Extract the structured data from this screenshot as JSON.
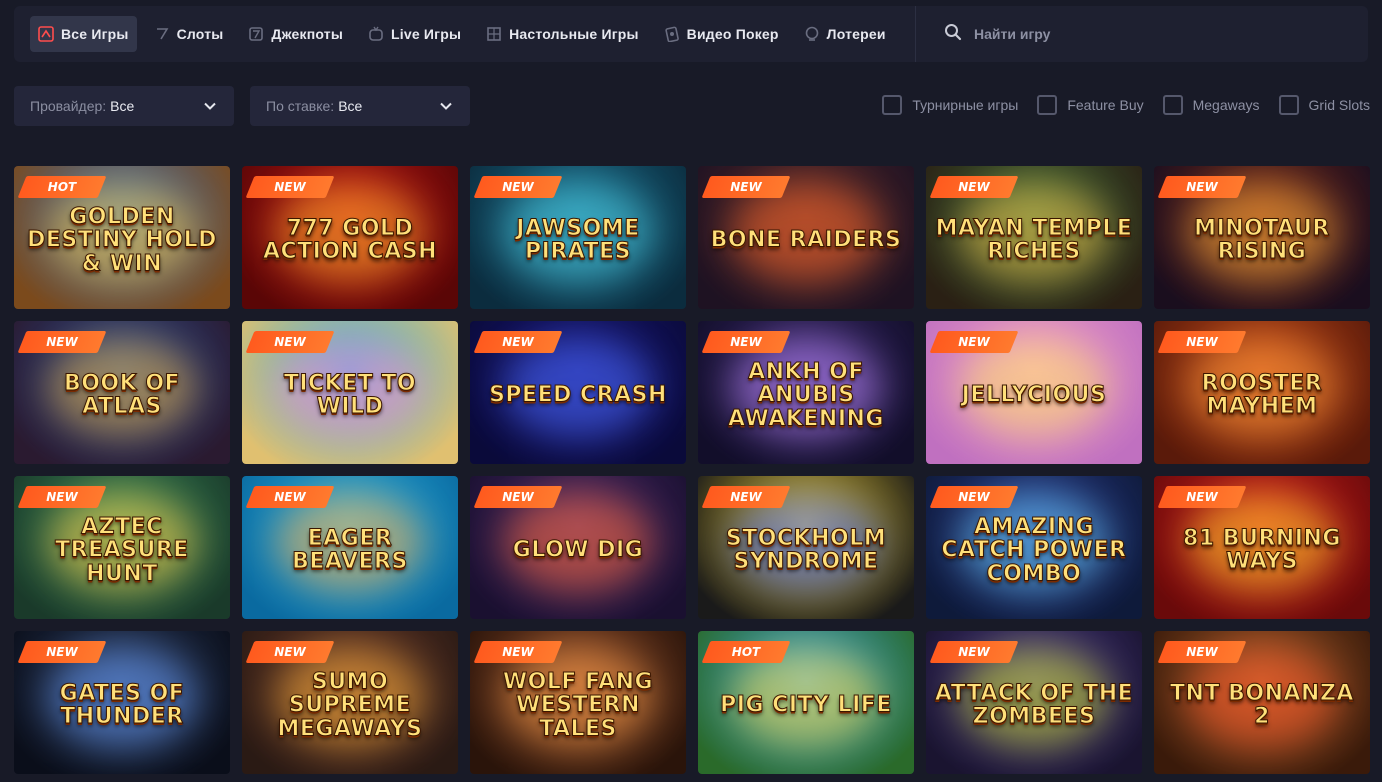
{
  "nav": {
    "tabs": [
      {
        "label": "Все Игры",
        "icon": "all-games-icon",
        "active": true
      },
      {
        "label": "Слоты",
        "icon": "slots-icon",
        "active": false
      },
      {
        "label": "Джекпоты",
        "icon": "jackpot-icon",
        "active": false
      },
      {
        "label": "Live Игры",
        "icon": "live-games-icon",
        "active": false
      },
      {
        "label": "Настольные Игры",
        "icon": "table-games-icon",
        "active": false
      },
      {
        "label": "Видео Покер",
        "icon": "video-poker-icon",
        "active": false
      },
      {
        "label": "Лотереи",
        "icon": "lottery-icon",
        "active": false
      }
    ],
    "search_placeholder": "Найти игру",
    "search_icon": "search-icon"
  },
  "filters": {
    "provider": {
      "label": "Провайдер:",
      "value": "Все"
    },
    "stake": {
      "label": "По ставке:",
      "value": "Все"
    },
    "checkboxes": [
      {
        "label": "Турнирные игры",
        "checked": false
      },
      {
        "label": "Feature Buy",
        "checked": false
      },
      {
        "label": "Megaways",
        "checked": false
      },
      {
        "label": "Grid Slots",
        "checked": false
      }
    ]
  },
  "colors": {
    "background": "#181a27",
    "panel": "#1e2030",
    "active_tab": "#32364a",
    "badge": "#ff5a1e"
  },
  "games": [
    {
      "badge": "HOT",
      "title": "Golden Destiny Hold & Win",
      "c1": "#3b6fb0",
      "c2": "#7b4a1c",
      "glow": "#ffcf4a"
    },
    {
      "badge": "NEW",
      "title": "777 Gold Action Cash",
      "c1": "#c01818",
      "c2": "#5a0606",
      "glow": "#ffb02a"
    },
    {
      "badge": "NEW",
      "title": "Jawsome Pirates",
      "c1": "#1c6f8c",
      "c2": "#0b2c3e",
      "glow": "#4fd1e6"
    },
    {
      "badge": "NEW",
      "title": "Bone Raiders",
      "c1": "#5a2a2a",
      "c2": "#1e1222",
      "glow": "#ff6a2a"
    },
    {
      "badge": "NEW",
      "title": "Mayan Temple Riches",
      "c1": "#3f6d3a",
      "c2": "#2a2014",
      "glow": "#f0c24a"
    },
    {
      "badge": "NEW",
      "title": "Minotaur Rising",
      "c1": "#7a2a1a",
      "c2": "#1a0e1e",
      "glow": "#ffb03a"
    },
    {
      "badge": "NEW",
      "title": "Book of Atlas",
      "c1": "#2a4a8c",
      "c2": "#2a1a30",
      "glow": "#e8b44a"
    },
    {
      "badge": "NEW",
      "title": "Ticket to Wild",
      "c1": "#3ab0d8",
      "c2": "#e0c070",
      "glow": "#ff8ad0"
    },
    {
      "badge": "NEW",
      "title": "Speed Crash",
      "c1": "#1a1a7a",
      "c2": "#0a0a3a",
      "glow": "#4a6aff"
    },
    {
      "badge": "NEW",
      "title": "Ankh of Anubis Awakening",
      "c1": "#3a2a6a",
      "c2": "#120e2a",
      "glow": "#c08aff"
    },
    {
      "badge": "NEW",
      "title": "Jellycious",
      "c1": "#f0a0c8",
      "c2": "#c070c0",
      "glow": "#ffe06a"
    },
    {
      "badge": "NEW",
      "title": "Rooster Mayhem",
      "c1": "#c04a1a",
      "c2": "#5a1a0a",
      "glow": "#ff9a3a"
    },
    {
      "badge": "NEW",
      "title": "Aztec Treasure Hunt",
      "c1": "#3a8a5a",
      "c2": "#1a3a2a",
      "glow": "#ffd04a"
    },
    {
      "badge": "NEW",
      "title": "Eager Beavers",
      "c1": "#2ab0e0",
      "c2": "#0a6aa0",
      "glow": "#ffb04a"
    },
    {
      "badge": "NEW",
      "title": "Glow Dig",
      "c1": "#4a2a6a",
      "c2": "#1a1030",
      "glow": "#ff6a3a"
    },
    {
      "badge": "NEW",
      "title": "Stockholm Syndrome",
      "c1": "#e8c82a",
      "c2": "#1a1a1a",
      "glow": "#4a6aff"
    },
    {
      "badge": "NEW",
      "title": "Amazing Catch Power Combo",
      "c1": "#2a3a8a",
      "c2": "#0e1a3a",
      "glow": "#6ad0ff"
    },
    {
      "badge": "NEW",
      "title": "81 Burning Ways",
      "c1": "#d02020",
      "c2": "#6a0a0a",
      "glow": "#ffd02a"
    },
    {
      "badge": "NEW",
      "title": "Gates of Thunder",
      "c1": "#2a3a5a",
      "c2": "#0a0e1a",
      "glow": "#6aa0ff"
    },
    {
      "badge": "NEW",
      "title": "Sumo Supreme Megaways",
      "c1": "#6a3a2a",
      "c2": "#2a1a14",
      "glow": "#ffb03a"
    },
    {
      "badge": "NEW",
      "title": "Wolf Fang Western Tales",
      "c1": "#8a4a2a",
      "c2": "#2a140a",
      "glow": "#ffa04a"
    },
    {
      "badge": "HOT",
      "title": "Pig City Life",
      "c1": "#3aa0d8",
      "c2": "#2a6a2a",
      "glow": "#ffe04a"
    },
    {
      "badge": "NEW",
      "title": "Attack of the Zombees",
      "c1": "#4a3a8a",
      "c2": "#1a1430",
      "glow": "#d0e02a"
    },
    {
      "badge": "NEW",
      "title": "TNT Bonanza 2",
      "c1": "#a05a2a",
      "c2": "#3a1a0a",
      "glow": "#ff5a2a"
    }
  ]
}
